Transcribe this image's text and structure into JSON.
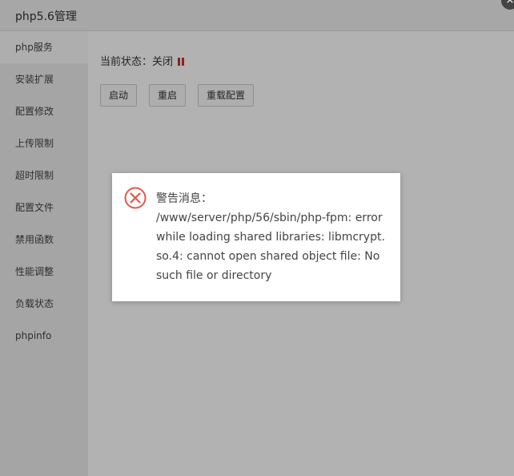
{
  "window": {
    "title": "php5.6管理",
    "close_glyph": "×"
  },
  "sidebar": {
    "items": [
      {
        "label": "php服务",
        "active": true
      },
      {
        "label": "安装扩展"
      },
      {
        "label": "配置修改"
      },
      {
        "label": "上传限制"
      },
      {
        "label": "超时限制"
      },
      {
        "label": "配置文件"
      },
      {
        "label": "禁用函数"
      },
      {
        "label": "性能调整"
      },
      {
        "label": "负载状态"
      },
      {
        "label": "phpinfo"
      }
    ]
  },
  "service": {
    "status_label": "当前状态：关闭",
    "status_icon": "pause-icon",
    "status_color": "#c9302c",
    "buttons": {
      "start": "启动",
      "restart": "重启",
      "reload": "重载配置"
    }
  },
  "dialog": {
    "icon": "error-circle-icon",
    "icon_color": "#e05a4a",
    "title": "警告消息：",
    "message": "/www/server/php/56/sbin/php-fpm: error while loading shared libraries: libmcrypt.so.4: cannot open shared object file: No such file or directory"
  }
}
